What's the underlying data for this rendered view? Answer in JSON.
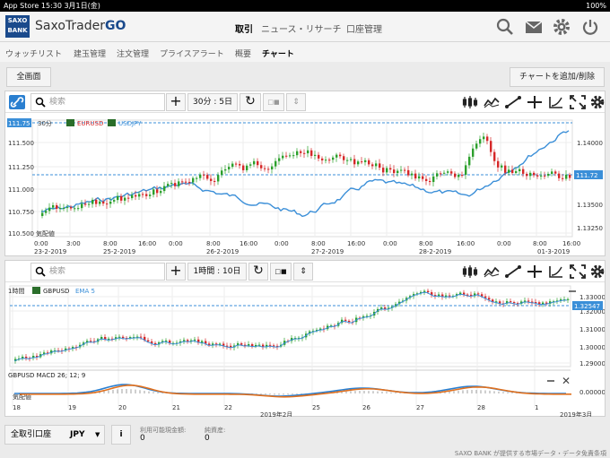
{
  "status_bar": {
    "left": "App Store  15:30  3月1日(金)",
    "battery": "100%"
  },
  "brand": {
    "logo_top": "SAXO",
    "logo_bottom": "BANK",
    "name": "SaxoTrader",
    "suffix": "GO"
  },
  "nav": [
    "取引",
    "ニュース・リサーチ",
    "口座管理"
  ],
  "subnav": [
    "ウォッチリスト",
    "建玉管理",
    "注文管理",
    "プライスアラート",
    "概要",
    "チャート"
  ],
  "actions": {
    "fullscreen": "全画面",
    "add_remove_chart": "チャートを追加/削除"
  },
  "chart1": {
    "search_placeholder": "検索",
    "interval": "30分 : 5日",
    "timeframe_label": "30分",
    "legend": [
      "EURUSD",
      "USDJPY"
    ],
    "price_tag_left": "111.75",
    "price_tag_right_top": "1.14",
    "price_tag_right": "111.72",
    "yaxis_left": [
      "111.500",
      "111.250",
      "111.000",
      "110.750",
      "110.500"
    ],
    "yaxis_right": [
      "1.14000",
      "1.13750",
      "1.13500",
      "1.13250"
    ],
    "xticks": [
      "0:00",
      "3:00",
      "8:00",
      "16:00",
      "0:00",
      "8:00",
      "16:00",
      "0:00",
      "8:00",
      "16:00",
      "0:00",
      "8:00",
      "16:00",
      "0:00",
      "8:00",
      "16:00"
    ],
    "xdates": [
      "23-2-2019",
      "25-2-2019",
      "26-2-2019",
      "27-2-2019",
      "28-2-2019",
      "01-3-2019"
    ],
    "note": "気配値"
  },
  "chart2": {
    "search_placeholder": "検索",
    "interval": "1時間 : 10日",
    "timeframe_label": "1時間",
    "symbol": "GBPUSD",
    "indicator": "EMA 5",
    "price_tag": "1.32547",
    "yaxis": [
      "1.33000",
      "1.32000",
      "1.31000",
      "1.30000",
      "1.29000"
    ],
    "macd_label": "GBPUSD  MACD 26; 12; 9",
    "macd_note": "気配値",
    "macd_yaxis": "0.00000",
    "xticks": [
      "18",
      "19",
      "20",
      "21",
      "22",
      "25",
      "26",
      "27",
      "28",
      "1"
    ],
    "xmonth": "2019年2月",
    "xmonth_right": "2019年3月"
  },
  "footer": {
    "account": "全取引口座",
    "currency": "JPY",
    "info": "i",
    "cash_label": "利用可能現金額:",
    "cash_value": "0",
    "net_label": "純資産:",
    "net_value": "0",
    "disclaimer": "SAXO BANK が提供する市場データ・データ免責条項"
  },
  "colors": {
    "up": "#2ca02c",
    "down": "#d62728",
    "line": "#3b8fd8",
    "macd": "#2a7fd0",
    "signal": "#e0701e"
  }
}
